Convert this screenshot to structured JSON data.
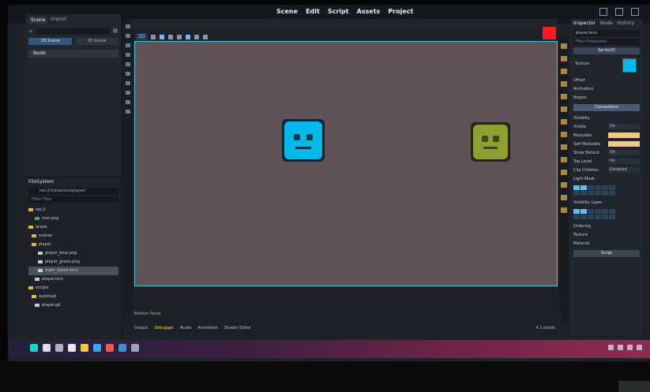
{
  "menu": [
    "Scene",
    "Edit",
    "Script",
    "Assets",
    "Project"
  ],
  "left_dock": {
    "tabs": [
      "Scene",
      "Import"
    ],
    "scene_buttons": [
      "2D Scene",
      "3D Scene"
    ],
    "tree_root": "Node",
    "filesystem_title": "FileSystem",
    "path": "res://characters/player/",
    "filter_placeholder": "Filter Files",
    "items": [
      "res://",
      "icon.png",
      "levels",
      "scenes",
      "player",
      "player_blue.png",
      "player_green.png",
      "main_scene.tscn",
      "player.tscn",
      "scripts",
      "autoload",
      "player.gd"
    ]
  },
  "viewport": {
    "mode_label": "2D",
    "bg_color": "#605258",
    "border_color": "#46c8d0"
  },
  "sprites": {
    "blue_icon": "godot-blue-icon",
    "green_icon": "godot-green-icon"
  },
  "bottom": {
    "title": "Bottom Panel",
    "tabs": [
      "Output",
      "Debugger",
      "Audio",
      "Animation",
      "Shader Editor"
    ],
    "active_tab": "Debugger",
    "version": "4.3.stable"
  },
  "inspector": {
    "tabs": [
      "Inspector",
      "Node",
      "History"
    ],
    "path": "player.tscn",
    "filter": "Filter Properties",
    "sections": [
      "Sprite2D",
      "Texture",
      "Offset",
      "Animation",
      "Region",
      "CanvasItem",
      "Visibility"
    ],
    "props": [
      {
        "label": "Visible",
        "value": "On"
      },
      {
        "label": "Modulate",
        "value": ""
      },
      {
        "label": "Self Modulate",
        "value": ""
      },
      {
        "label": "Show Behind",
        "value": "On"
      },
      {
        "label": "Top Level",
        "value": "On"
      },
      {
        "label": "Clip Children",
        "value": "Disabled"
      }
    ],
    "layer_label": "Light Mask",
    "vis_layer_label": "Visibility Layer",
    "bottom_sections": [
      "Ordering",
      "Texture",
      "Material",
      "Script"
    ]
  },
  "colors": {
    "taskbar_start": "#23203a",
    "taskbar_end": "#8f2b52",
    "accent_red": "#ff1a20"
  }
}
